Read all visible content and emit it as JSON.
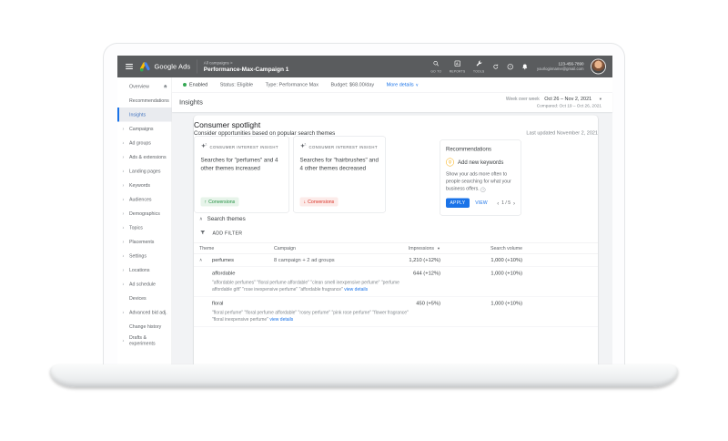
{
  "topbar": {
    "product_name": "Google Ads",
    "breadcrumb_small": "All campaigns >",
    "campaign_name": "Performance-Max-Campaign 1",
    "nav_icons": [
      {
        "name": "search",
        "label": "GO TO"
      },
      {
        "name": "reports",
        "label": "REPORTS"
      },
      {
        "name": "tools",
        "label": "TOOLS"
      }
    ],
    "phone": "123-456-7890",
    "email": "yourloginname@gmail.com"
  },
  "statusbar": {
    "enabled": "Enabled",
    "status": "Status: Eligible",
    "type": "Type: Performance Max",
    "budget": "Budget: $68.00/day",
    "more_details": "More details"
  },
  "sidebar": {
    "items": [
      {
        "label": "Overview",
        "icon": "home"
      },
      {
        "label": "Recommendations"
      },
      {
        "label": "Insights",
        "selected": true
      },
      {
        "label": "Campaigns",
        "expandable": true
      },
      {
        "label": "Ad groups",
        "expandable": true
      },
      {
        "label": "Ads & extensions",
        "expandable": true
      },
      {
        "label": "Landing pages",
        "expandable": true
      },
      {
        "label": "Keywords",
        "expandable": true
      },
      {
        "label": "Audiences",
        "expandable": true
      },
      {
        "label": "Demographics",
        "expandable": true
      },
      {
        "label": "Topics",
        "expandable": true
      },
      {
        "label": "Placements",
        "expandable": true
      },
      {
        "label": "Settings",
        "expandable": true
      },
      {
        "label": "Locations",
        "expandable": true
      },
      {
        "label": "Ad schedule",
        "expandable": true
      },
      {
        "label": "Devices"
      },
      {
        "label": "Advanced bid adj.",
        "expandable": true
      },
      {
        "label": "Change history"
      },
      {
        "label": "Drafts & experiments",
        "expandable": true,
        "wrap": true
      }
    ]
  },
  "page": {
    "title": "Insights",
    "range_label": "Week over week",
    "range": "Oct 26 – Nov 2, 2021",
    "compared": "Compared: Oct 19 – Oct 26, 2021"
  },
  "spotlight": {
    "title": "Consumer spotlight",
    "subtitle": "Consider opportunities based on popular search themes",
    "last_updated": "Last updated November 2, 2021",
    "cards": [
      {
        "tag": "CONSUMER INTEREST INSIGHT",
        "text": "Searches for \"perfumes\" and 4 other themes increased",
        "badge": "Conversions",
        "direction": "up"
      },
      {
        "tag": "CONSUMER INTEREST INSIGHT",
        "text": "Searches for \"hairbrushes\" and 4 other themes decreased",
        "badge": "Conversions",
        "direction": "down"
      }
    ]
  },
  "recommendations": {
    "title": "Recommendations",
    "item_title": "Add new keywords",
    "body": "Show your ads more often to people searching for what your business offers.",
    "apply_label": "APPLY",
    "view_label": "VIEW",
    "pager": "1 / 5"
  },
  "search_themes": {
    "title": "Search themes",
    "add_filter": "ADD FILTER",
    "columns": [
      "Theme",
      "Campaign",
      "Impressions",
      "Search volume"
    ],
    "rows": [
      {
        "theme": "perfumes",
        "campaign": "8 campaign + 2 ad groups",
        "impressions": "1,210 (+12%)",
        "volume": "1,000 (+10%)"
      },
      {
        "theme": "affordable",
        "impressions": "644 (+12%)",
        "volume": "1,000 (+10%)",
        "desc": "\"affordable perfumes\" \"floral perfume affordable\" \"clean smell inexpensive perfume\" \"perfume affordable gift\" \"rose inexpensive perfume\" \"affordable fragrance\"",
        "link_label": "view details"
      },
      {
        "theme": "floral",
        "impressions": "450 (+5%)",
        "volume": "1,000 (+10%)",
        "desc": "\"floral perfume\" \"floral perfume affordable\" \"rosey perfume\" \"pink rose perfume\" \"flower fragrance\" \"floral inexpensive perfume\"",
        "link_label": "view details"
      }
    ]
  },
  "colors": {
    "accent_blue": "#1a73e8",
    "enabled_green": "#34a853",
    "badge_up_green": "#1e8e3e",
    "badge_down_red": "#d93025",
    "recommendation_amber": "#f9ab00",
    "topbar_gray": "#5a5c5e"
  }
}
